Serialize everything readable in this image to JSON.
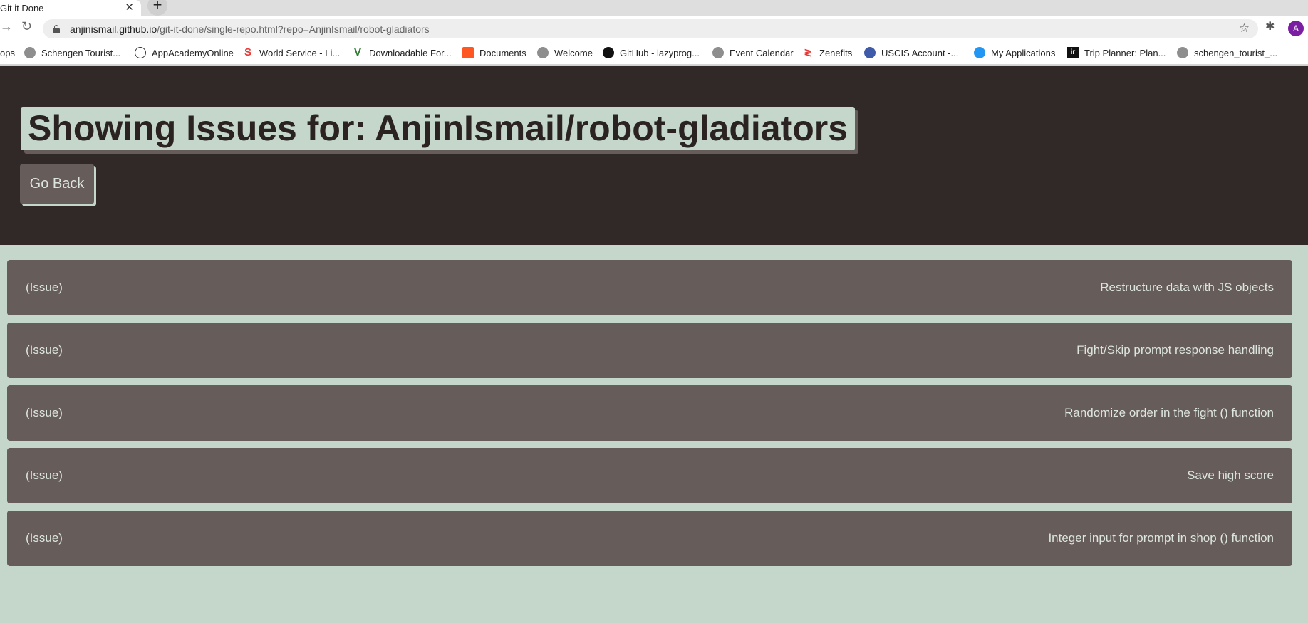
{
  "browser": {
    "tab_title": "Git it Done",
    "tab_close": "✕",
    "new_tab": "+",
    "url_host": "anjinismail.github.io",
    "url_path": "/git-it-done/single-repo.html?repo=AnjinIsmail/robot-gladiators",
    "avatar_letter": "A",
    "bookmarks": [
      {
        "label": "ops",
        "icon": "none"
      },
      {
        "label": "Schengen Tourist...",
        "icon": "globe-icon"
      },
      {
        "label": "AppAcademyOnline",
        "icon": "aao-icon"
      },
      {
        "label": "World Service - Li...",
        "icon": "ws-icon"
      },
      {
        "label": "Downloadable For...",
        "icon": "v-icon"
      },
      {
        "label": "Documents",
        "icon": "docs-icon"
      },
      {
        "label": "Welcome",
        "icon": "globe-icon"
      },
      {
        "label": "GitHub - lazyprog...",
        "icon": "github-icon"
      },
      {
        "label": "Event Calendar",
        "icon": "globe-icon"
      },
      {
        "label": "Zenefits",
        "icon": "zenefits-icon"
      },
      {
        "label": "USCIS Account -...",
        "icon": "uscis-icon"
      },
      {
        "label": "My Applications",
        "icon": "bulb-icon"
      },
      {
        "label": "Trip Planner: Plan...",
        "icon": "ir-icon"
      },
      {
        "label": "schengen_tourist_...",
        "icon": "globe-icon"
      }
    ]
  },
  "page": {
    "title": "Showing Issues for: AnjinIsmail/robot-gladiators",
    "go_back_label": "Go Back",
    "colors": {
      "header_bg": "#312928",
      "page_bg": "#c5d7cb",
      "card_bg": "#665c5a",
      "card_text": "#dde5df"
    },
    "issues": [
      {
        "type": "(Issue)",
        "title": "Restructure data with JS objects"
      },
      {
        "type": "(Issue)",
        "title": "Fight/Skip prompt response handling"
      },
      {
        "type": "(Issue)",
        "title": "Randomize order in the fight () function"
      },
      {
        "type": "(Issue)",
        "title": "Save high score"
      },
      {
        "type": "(Issue)",
        "title": "Integer input for prompt in shop () function"
      }
    ]
  }
}
